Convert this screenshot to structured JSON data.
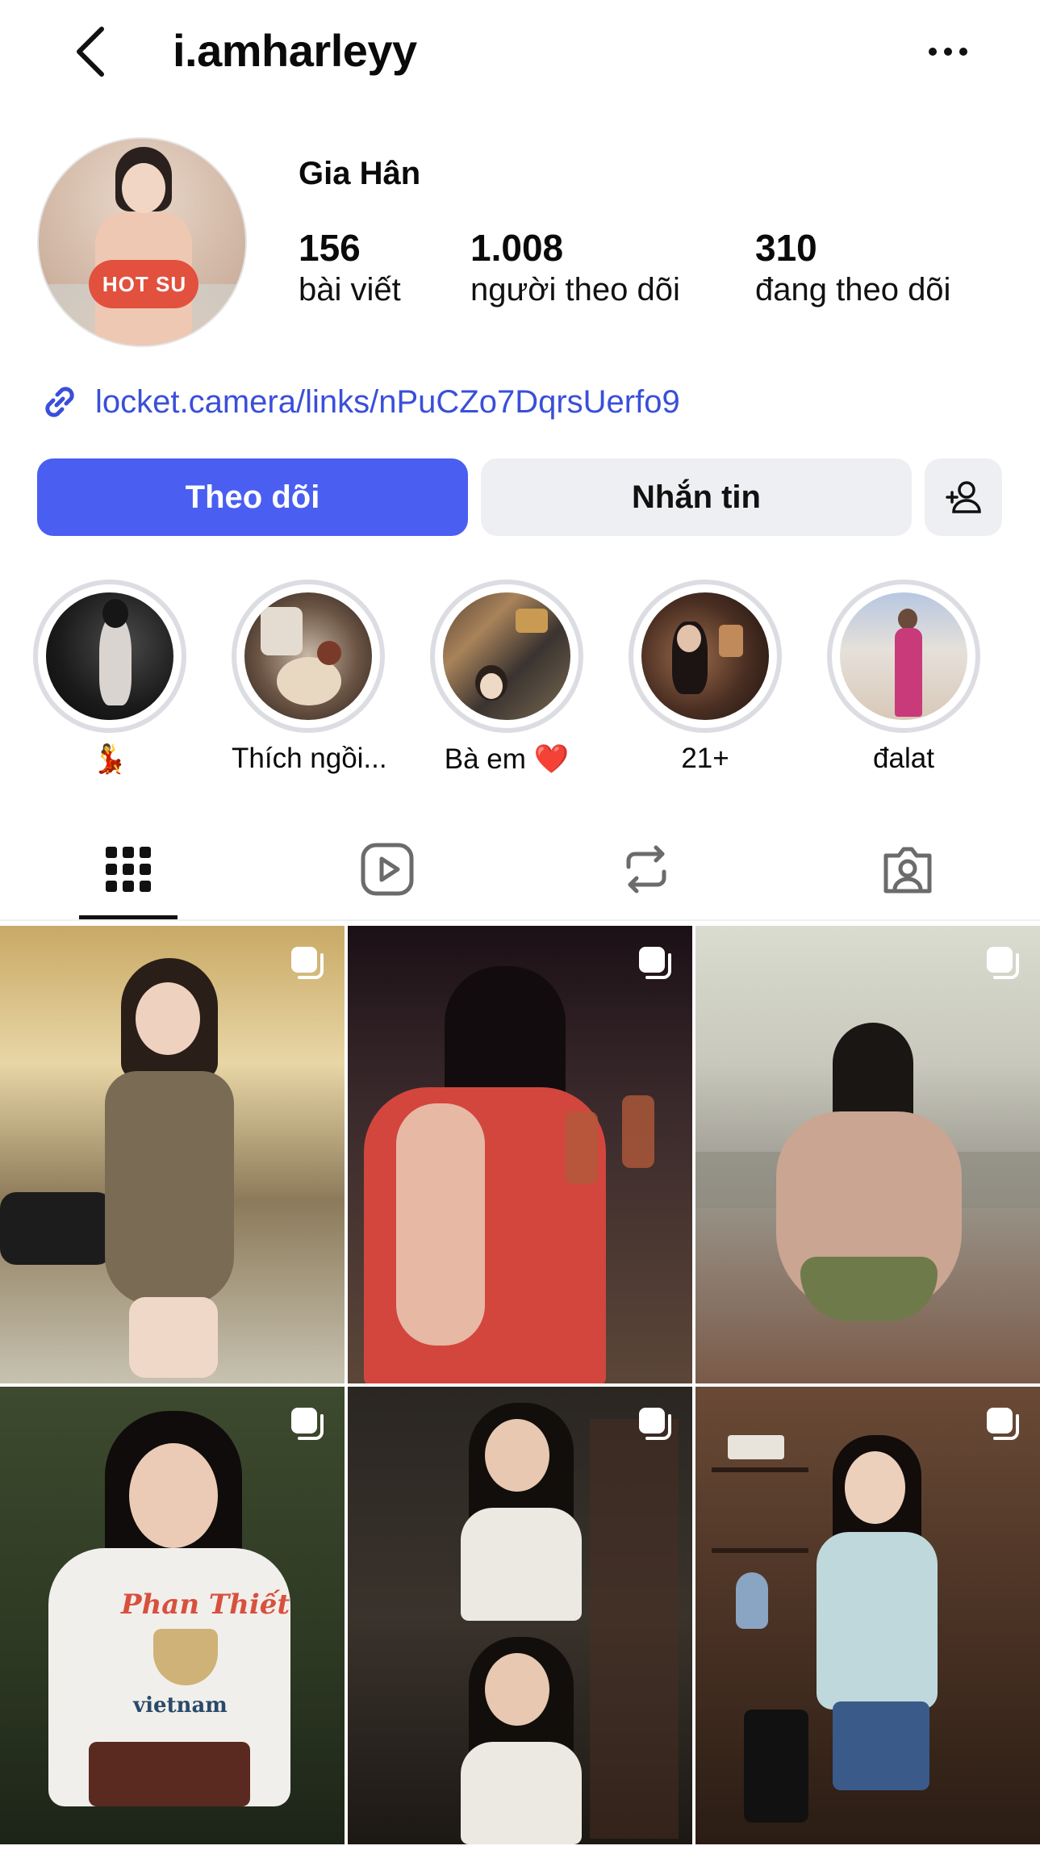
{
  "header": {
    "username": "i.amharleyy",
    "back_icon": "chevron-left-icon",
    "more_icon": "more-horizontal-icon"
  },
  "profile": {
    "display_name": "Gia Hân",
    "stats": {
      "posts_count": "156",
      "posts_label": "bài viết",
      "followers_count": "1.008",
      "followers_label": "người theo dõi",
      "following_count": "310",
      "following_label": "đang theo dõi"
    },
    "link": "locket.camera/links/nPuCZo7DqrsUerfo9",
    "avatar_shirt_text": "HOT SU"
  },
  "actions": {
    "follow_label": "Theo dõi",
    "message_label": "Nhắn tin",
    "add_user_icon": "add-person-icon"
  },
  "highlights": [
    {
      "label": "💃"
    },
    {
      "label": "Thích ngồi..."
    },
    {
      "label": "Bà em ❤️"
    },
    {
      "label": "21+"
    },
    {
      "label": "đalat"
    }
  ],
  "tabs": [
    {
      "name": "posts",
      "icon": "grid-icon",
      "active": true
    },
    {
      "name": "reels",
      "icon": "reels-icon",
      "active": false
    },
    {
      "name": "reposts",
      "icon": "repost-icon",
      "active": false
    },
    {
      "name": "tagged",
      "icon": "tagged-person-icon",
      "active": false
    }
  ],
  "posts": [
    {
      "type": "carousel"
    },
    {
      "type": "carousel"
    },
    {
      "type": "carousel"
    },
    {
      "type": "carousel",
      "shirt_text_1": "Phan Thiết",
      "shirt_text_2": "vietnam"
    },
    {
      "type": "carousel"
    },
    {
      "type": "carousel"
    }
  ],
  "colors": {
    "primary_button": "#4a5ef2",
    "link": "#3a4fd8",
    "secondary_button": "#eeeff2"
  }
}
